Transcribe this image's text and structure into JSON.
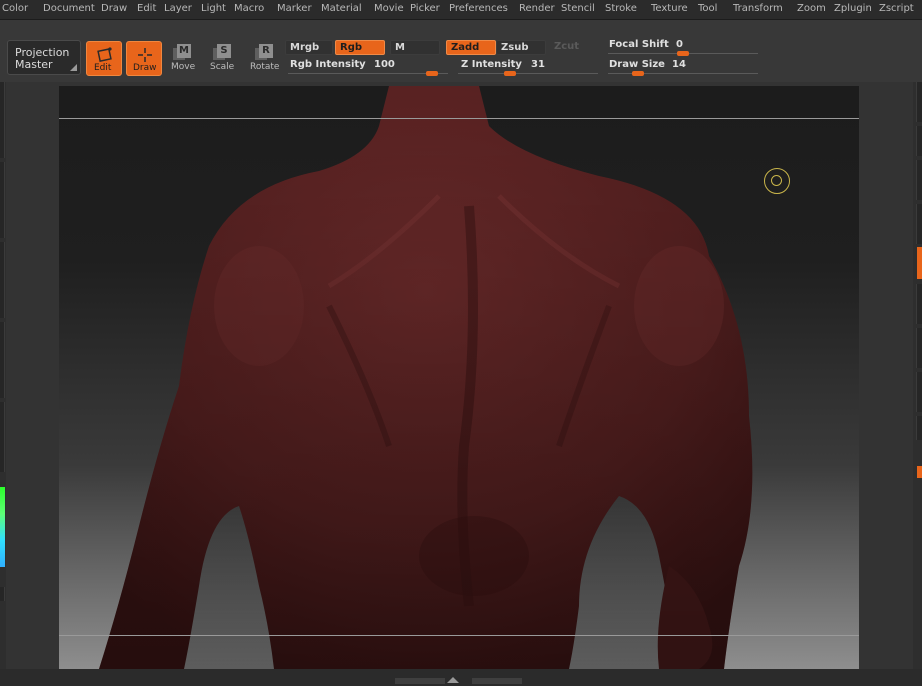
{
  "menu": [
    "Color",
    "Document",
    "Draw",
    "Edit",
    "Layer",
    "Light",
    "Macro",
    "Marker",
    "Material",
    "Movie",
    "Picker",
    "Preferences",
    "Render",
    "Stencil",
    "Stroke",
    "Texture",
    "Tool",
    "Transform",
    "Zoom",
    "Zplugin",
    "Zscript"
  ],
  "toolbar": {
    "projection_line1": "Projection",
    "projection_line2": "Master",
    "edit_label": "Edit",
    "draw_label": "Draw",
    "move_label": "Move",
    "move_glyph": "M",
    "scale_label": "Scale",
    "scale_glyph": "S",
    "rotate_label": "Rotate",
    "rotate_glyph": "R",
    "mrgb": "Mrgb",
    "rgb": "Rgb",
    "m": "M",
    "rgb_intensity_label": "Rgb  Intensity",
    "rgb_intensity_value": "100",
    "zadd": "Zadd",
    "zsub": "Zsub",
    "zcut": "Zcut",
    "z_intensity_label": "Z  Intensity",
    "z_intensity_value": "31",
    "focal_shift_label": "Focal  Shift",
    "focal_shift_value": "0",
    "draw_size_label": "Draw  Size",
    "draw_size_value": "14",
    "rgb_intensity_level": 0.9,
    "z_intensity_level": 0.37,
    "focal_shift_level": 0.5,
    "draw_size_level": 0.2
  },
  "colors": {
    "accent": "#e8651b",
    "skin": "#5e2424",
    "cursor": "#c9b54a"
  }
}
